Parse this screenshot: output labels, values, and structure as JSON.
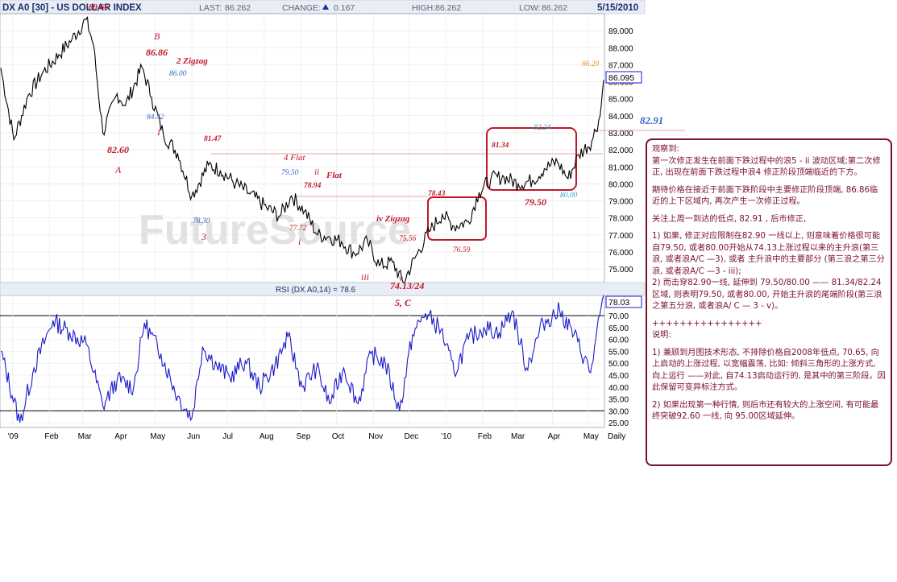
{
  "header": {
    "symbol": "DX A0 [30] - US DOLLAR INDEX",
    "last_label": "LAST:",
    "last_value": "86.262",
    "change_label": "CHANGE:",
    "change_value": "0.167",
    "change_icon": "triangle-up-icon",
    "high_label": "HIGH:",
    "high_value": "86.262",
    "low_label": "LOW:",
    "low_value": "86.262",
    "date": "5/15/2010"
  },
  "watermark": "FutureSource",
  "rsi_label": "RSI (DX A0,14) = 78.6",
  "colors": {
    "price_line": "#000000",
    "rsi_line": "#1a1acc",
    "wave_label": "#c0182a",
    "price_note": "#3a66c8",
    "box": "#c0182a",
    "note_text": "#7a1030",
    "header_bg": "#e9edf5"
  },
  "annotations": {
    "top_price": "89.66",
    "b_price": "86.86",
    "b_label": "B",
    "zigzag2": "2  Zigzag",
    "p8600": "86.00",
    "p8442": "84.42",
    "w1": "1",
    "p8260": "82.60",
    "a_label": "A",
    "p8147": "81.47",
    "p7830": "78.30",
    "w3": "3",
    "flat4": "4  Flat",
    "p7950a": "79.50",
    "ii_flat_ii": "ii",
    "ii_flat": "Flat",
    "p7894": "78.94",
    "p7772": "77.72",
    "wi": "i",
    "iv_zigzag": "iv  Zigzag",
    "p7843": "78.43",
    "p7556": "75.56",
    "wiii": "iii",
    "wv": "v",
    "p7413": "74.13/24",
    "w5c": "5, C",
    "p7659": "76.59",
    "p8134": "81.34",
    "p8224": "82.24",
    "p8000": "80.00",
    "p7950b": "79.50",
    "p8629": "86.29",
    "p8291": "82.91"
  },
  "notes": [
    "观察到:\n第一次修正发生在前面下跌过程中的浪5 - ii 波动区域;第二次修正, 出现在前面下跌过程中浪4 修正阶段顶端临近的下方。",
    "期待价格在接近于前面下跌阶段中主要修正阶段顶端, 86.86临近的上下区域内, 再次产生一次修正过程。",
    "关注上周一到达的低点, 82.91 , 后市修正,",
    "1) 如果, 修正对应限制在82.90 一线以上, 则意味着价格很可能自79.50, 或者80.00开始从74.13上涨过程以来的主升浪(第三浪, 或者浪A/C —3), 或者 主升浪中的主要部分 (第三浪之第三分浪, 或者浪A/C —3 - iii);\n2) 而击穿82.90一线, 延伸到 79.50/80.00 —— 81.34/82.24区域, 则表明79.50, 或者80.00, 开始主升浪的尾端阶段(第三浪之第五分浪, 或者浪A/ C — 3 - v)。",
    "++++++++++++++++\n说明:",
    "1) 兼顾到月图技术形态, 不排除价格自2008年低点, 70.65, 向上启动的上涨过程, 以宽幅震荡, 比如: 倾斜三角形的上涨方式, 向上运行 ——对此, 自74.13启动运行的, 是其中的第三阶段。因此保留可变异标注方式。",
    "2) 如果出现第一种行情, 则后市还有较大的上涨空间, 有可能最终突破92.60 一线, 向 95.00区域延伸。"
  ],
  "chart_data": [
    {
      "type": "line",
      "title": "DX A0 [30] - US DOLLAR INDEX",
      "frequency": "Daily",
      "x_ticks": [
        "'09",
        "Feb",
        "Mar",
        "Apr",
        "May",
        "Jun",
        "Jul",
        "Aug",
        "Sep",
        "Oct",
        "Nov",
        "Dec",
        "'10",
        "Feb",
        "Mar",
        "Apr",
        "May",
        "Daily"
      ],
      "y_ticks": [
        75.0,
        76.0,
        77.0,
        78.0,
        79.0,
        80.0,
        81.0,
        82.0,
        83.0,
        84.0,
        85.0,
        86.0,
        87.0,
        88.0,
        89.0
      ],
      "ylim": [
        74.2,
        90.0
      ],
      "last_value_marker": "86.095",
      "series": [
        {
          "x": [
            "2008-12-22",
            "2009-01-02",
            "2009-01-14",
            "2009-01-26",
            "2009-02-09",
            "2009-02-20",
            "2009-03-04",
            "2009-03-10",
            "2009-03-18",
            "2009-03-30",
            "2009-04-06",
            "2009-04-20",
            "2009-04-28",
            "2009-05-08",
            "2009-05-20",
            "2009-06-01",
            "2009-06-15",
            "2009-06-25",
            "2009-07-08",
            "2009-07-20",
            "2009-08-03",
            "2009-08-14",
            "2009-08-24",
            "2009-09-04",
            "2009-09-15",
            "2009-09-24",
            "2009-10-05",
            "2009-10-16",
            "2009-10-27",
            "2009-11-06",
            "2009-11-17",
            "2009-11-26",
            "2009-12-08",
            "2009-12-18",
            "2009-12-29",
            "2010-01-08",
            "2010-01-20",
            "2010-01-29",
            "2010-02-08",
            "2010-02-19",
            "2010-03-03",
            "2010-03-15",
            "2010-03-25",
            "2010-04-05",
            "2010-04-14",
            "2010-04-23",
            "2010-05-04",
            "2010-05-11",
            "2010-05-14"
          ],
          "values": [
            86.8,
            82.6,
            85.2,
            86.5,
            87.6,
            88.5,
            89.66,
            88.2,
            83.0,
            85.3,
            84.6,
            86.86,
            85.1,
            82.9,
            81.8,
            79.3,
            81.1,
            80.8,
            80.0,
            79.4,
            78.6,
            78.1,
            79.3,
            78.4,
            77.0,
            76.9,
            76.6,
            75.9,
            76.6,
            75.2,
            75.4,
            74.2,
            75.9,
            77.2,
            78.2,
            77.5,
            77.8,
            79.5,
            80.3,
            80.4,
            80.0,
            80.2,
            80.9,
            81.3,
            80.3,
            81.7,
            82.5,
            84.0,
            86.1
          ]
        }
      ]
    },
    {
      "type": "line",
      "title": "RSI (DX A0,14) = 78.6",
      "y_ticks": [
        25.0,
        30.0,
        35.0,
        40.0,
        45.0,
        50.0,
        55.0,
        60.0,
        65.0,
        70.0,
        75.0
      ],
      "ylim": [
        23.0,
        78.5
      ],
      "reference_lines": [
        70,
        30
      ],
      "last_value_marker": "78.03",
      "series": [
        {
          "x": [
            "2008-12-22",
            "2009-01-07",
            "2009-01-19",
            "2009-02-04",
            "2009-02-18",
            "2009-03-04",
            "2009-03-18",
            "2009-03-30",
            "2009-04-13",
            "2009-04-22",
            "2009-05-06",
            "2009-05-20",
            "2009-06-01",
            "2009-06-10",
            "2009-06-22",
            "2009-07-03",
            "2009-07-16",
            "2009-07-28",
            "2009-08-10",
            "2009-08-21",
            "2009-09-02",
            "2009-09-14",
            "2009-09-25",
            "2009-10-07",
            "2009-10-19",
            "2009-10-30",
            "2009-11-11",
            "2009-11-23",
            "2009-12-04",
            "2009-12-15",
            "2009-12-28",
            "2010-01-08",
            "2010-01-20",
            "2010-02-02",
            "2010-02-15",
            "2010-02-26",
            "2010-03-10",
            "2010-03-24",
            "2010-04-07",
            "2010-04-19",
            "2010-05-03",
            "2010-05-14"
          ],
          "values": [
            55,
            25,
            48,
            68,
            63,
            58,
            32,
            43,
            40,
            67,
            54,
            36,
            27,
            57,
            49,
            44,
            51,
            40,
            49,
            61,
            40,
            48,
            33,
            48,
            33,
            54,
            50,
            30,
            62,
            71,
            64,
            46,
            60,
            65,
            63,
            72,
            48,
            67,
            72,
            62,
            46,
            78.6
          ]
        }
      ]
    }
  ]
}
